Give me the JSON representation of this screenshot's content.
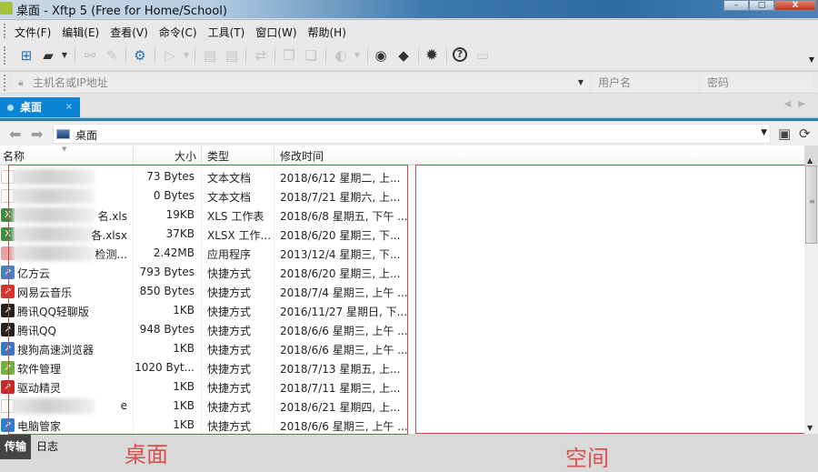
{
  "window": {
    "title": "桌面 - Xftp 5 (Free for Home/School)",
    "controls": {
      "minimize": "–",
      "maximize": "□",
      "close": "X"
    }
  },
  "menu": [
    "文件(F)",
    "编辑(E)",
    "查看(V)",
    "命令(C)",
    "工具(T)",
    "窗口(W)",
    "帮助(H)"
  ],
  "toolbar": {
    "icons": [
      {
        "name": "new-session-icon",
        "glyph": "⊞",
        "enabled": true
      },
      {
        "name": "open-folder-icon",
        "glyph": "▰",
        "enabled": true
      },
      {
        "name": "disconnect-icon",
        "glyph": "⚯",
        "enabled": false
      },
      {
        "name": "reconnect-icon",
        "glyph": "✎",
        "enabled": false
      },
      {
        "name": "session-properties-icon",
        "glyph": "⚙",
        "enabled": true
      },
      {
        "name": "transfer-icon",
        "glyph": "▷",
        "enabled": false
      },
      {
        "name": "upload-file-icon",
        "glyph": "▤",
        "enabled": false
      },
      {
        "name": "download-file-icon",
        "glyph": "▤",
        "enabled": false
      },
      {
        "name": "sync-icon",
        "glyph": "⇄",
        "enabled": false
      },
      {
        "name": "copy-icon",
        "glyph": "❐",
        "enabled": false
      },
      {
        "name": "paste-icon",
        "glyph": "❏",
        "enabled": false
      },
      {
        "name": "encoding-globe-icon",
        "glyph": "◐",
        "enabled": false
      },
      {
        "name": "xshell-icon",
        "glyph": "◉",
        "enabled": true
      },
      {
        "name": "xmanager-icon",
        "glyph": "◆",
        "enabled": true
      },
      {
        "name": "options-gear-icon",
        "glyph": "✹",
        "enabled": true
      },
      {
        "name": "help-icon",
        "glyph": "?",
        "enabled": true
      },
      {
        "name": "feedback-icon",
        "glyph": "▭",
        "enabled": false
      }
    ]
  },
  "address": {
    "host_placeholder": "主机名或IP地址",
    "user_placeholder": "用户名",
    "password_placeholder": "密码"
  },
  "tabs": [
    {
      "label": "桌面",
      "close": "×"
    }
  ],
  "nav": {
    "path": "桌面"
  },
  "columns": {
    "name": "名称",
    "size": "大小",
    "type": "类型",
    "modified": "修改时间"
  },
  "files": [
    {
      "name": "",
      "blurred": true,
      "size": "73 Bytes",
      "type": "文本文档",
      "modified": "2018/6/12 星期二, 上...",
      "icon": "text-file-icon",
      "color": "#ffffff"
    },
    {
      "name": "",
      "blurred": true,
      "size": "0 Bytes",
      "type": "文本文档",
      "modified": "2018/7/21 星期六, 上...",
      "icon": "text-file-icon",
      "color": "#ffffff"
    },
    {
      "name": "名.xls",
      "blurred": true,
      "size": "19KB",
      "type": "XLS 工作表",
      "modified": "2018/6/8 星期五, 下午 ...",
      "icon": "excel-file-icon",
      "color": "#3e8e41"
    },
    {
      "name": "各.xlsx",
      "blurred": true,
      "size": "37KB",
      "type": "XLSX 工作...",
      "modified": "2018/6/20 星期三, 下...",
      "icon": "excel-file-icon",
      "color": "#3e8e41"
    },
    {
      "name": "检测...",
      "blurred": true,
      "size": "2.42MB",
      "type": "应用程序",
      "modified": "2013/12/4 星期三, 下...",
      "icon": "application-icon",
      "color": "#e8a0a0"
    },
    {
      "name": "亿方云",
      "blurred": false,
      "size": "793 Bytes",
      "type": "快捷方式",
      "modified": "2018/6/20 星期三, 上...",
      "icon": "yifangyun-shortcut-icon",
      "color": "#4a7fc1"
    },
    {
      "name": "网易云音乐",
      "blurred": false,
      "size": "850 Bytes",
      "type": "快捷方式",
      "modified": "2018/7/4 星期三, 上午 ...",
      "icon": "netease-music-shortcut-icon",
      "color": "#d8342c"
    },
    {
      "name": "腾讯QQ轻聊版",
      "blurred": false,
      "size": "1KB",
      "type": "快捷方式",
      "modified": "2016/11/27 星期日, 下...",
      "icon": "qq-lite-shortcut-icon",
      "color": "#222222"
    },
    {
      "name": "腾讯QQ",
      "blurred": false,
      "size": "948 Bytes",
      "type": "快捷方式",
      "modified": "2018/6/6 星期三, 上午 ...",
      "icon": "qq-shortcut-icon",
      "color": "#222222"
    },
    {
      "name": "搜狗高速浏览器",
      "blurred": false,
      "size": "1KB",
      "type": "快捷方式",
      "modified": "2018/6/6 星期三, 上午 ...",
      "icon": "sogou-browser-shortcut-icon",
      "color": "#3a78c2"
    },
    {
      "name": "软件管理",
      "blurred": false,
      "size": "1020 Byt...",
      "type": "快捷方式",
      "modified": "2018/7/13 星期五, 上...",
      "icon": "software-manager-shortcut-icon",
      "color": "#6fb23a"
    },
    {
      "name": "驱动精灵",
      "blurred": false,
      "size": "1KB",
      "type": "快捷方式",
      "modified": "2018/7/11 星期三, 上...",
      "icon": "driver-genius-shortcut-icon",
      "color": "#c62828"
    },
    {
      "name": "e",
      "blurred": true,
      "size": "1KB",
      "type": "快捷方式",
      "modified": "2018/6/21 星期四, 上...",
      "icon": "shortcut-icon",
      "color": "#ffffff"
    },
    {
      "name": "电脑管家",
      "blurred": false,
      "size": "1KB",
      "type": "快捷方式",
      "modified": "2018/6/6 星期三, 上午 ...",
      "icon": "pc-manager-shortcut-icon",
      "color": "#2f7fd0"
    }
  ],
  "bottom_tabs": {
    "transfer": "传输",
    "log": "日志"
  },
  "annotations": {
    "left": "桌面",
    "right": "空间"
  },
  "colors": {
    "accent": "#0b84d6",
    "annotation": "#c9494b"
  }
}
